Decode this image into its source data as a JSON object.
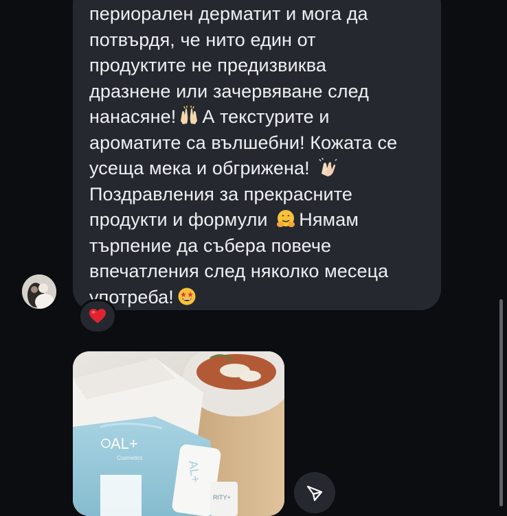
{
  "message": {
    "lines": [
      "периорален дерматит и мога да",
      "потвърдя, че нито един от",
      "продуктите не предизвиква",
      "дразнене или зачервяване след",
      "нанасяне!",
      "А текстурите и",
      "ароматите са вълшебни! Кожата се",
      "усеща мека и обгрижена!",
      "Поздравления за прекрасните",
      "продукти и формули",
      "Нямам",
      "търпение да събера повече",
      "впечатления след няколко месеца",
      "употреба!"
    ],
    "emojis": [
      "raising-hands-emoji",
      "clapping-hands-emoji",
      "hugging-face-emoji",
      "star-struck-emoji"
    ]
  },
  "reaction": {
    "emoji": "red-heart-emoji",
    "color": "#e0242f"
  },
  "photo": {
    "brand_lines": [
      "AL+",
      "Cosmetics"
    ],
    "bottle_label": "RITY+"
  },
  "colors": {
    "background": "#0b0d10",
    "bubble": "#25292f",
    "text": "#eef0f3"
  }
}
